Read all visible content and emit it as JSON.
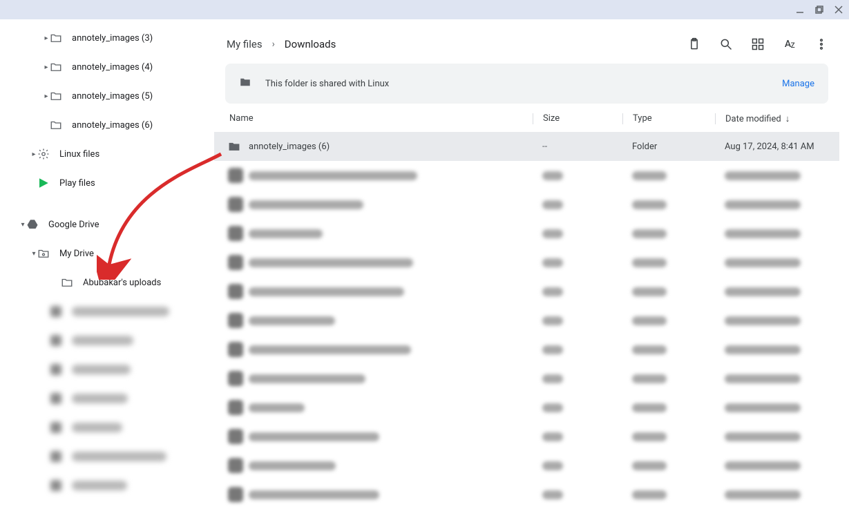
{
  "window": {
    "minimize": "—",
    "maximize": "❐",
    "close": "✕"
  },
  "sidebar": {
    "folders": [
      {
        "label": "annotely_images (3)",
        "indent": "lv1",
        "expand": "▸",
        "icon": "folder"
      },
      {
        "label": "annotely_images (4)",
        "indent": "lv1",
        "expand": "▸",
        "icon": "folder"
      },
      {
        "label": "annotely_images (5)",
        "indent": "lv1",
        "expand": "▸",
        "icon": "folder"
      },
      {
        "label": "annotely_images (6)",
        "indent": "lv1",
        "expand": "",
        "icon": "folder"
      },
      {
        "label": "Linux files",
        "indent": "lv2",
        "expand": "▸",
        "icon": "linux"
      },
      {
        "label": "Play files",
        "indent": "lv2",
        "expand": "",
        "icon": "play"
      },
      {
        "label": "Google Drive",
        "indent": "lv3",
        "expand": "▾",
        "icon": "drive"
      },
      {
        "label": "My Drive",
        "indent": "lv4",
        "expand": "▾",
        "icon": "mydrive"
      },
      {
        "label": "Abubakar's uploads",
        "indent": "lv5b",
        "expand": "",
        "icon": "folder"
      }
    ],
    "blurred_count": 7
  },
  "breadcrumb": {
    "root": "My files",
    "current": "Downloads"
  },
  "banner": {
    "text": "This folder is shared with Linux",
    "action": "Manage"
  },
  "columns": {
    "name": "Name",
    "size": "Size",
    "type": "Type",
    "date": "Date modified"
  },
  "rows": {
    "first": {
      "name": "annotely_images (6)",
      "size": "--",
      "type": "Folder",
      "date": "Aug 17, 2024, 8:41 AM"
    },
    "blurred_count": 12
  },
  "annotation": {
    "arrow_target": "Abubakar's uploads",
    "color": "#d92b2b"
  }
}
